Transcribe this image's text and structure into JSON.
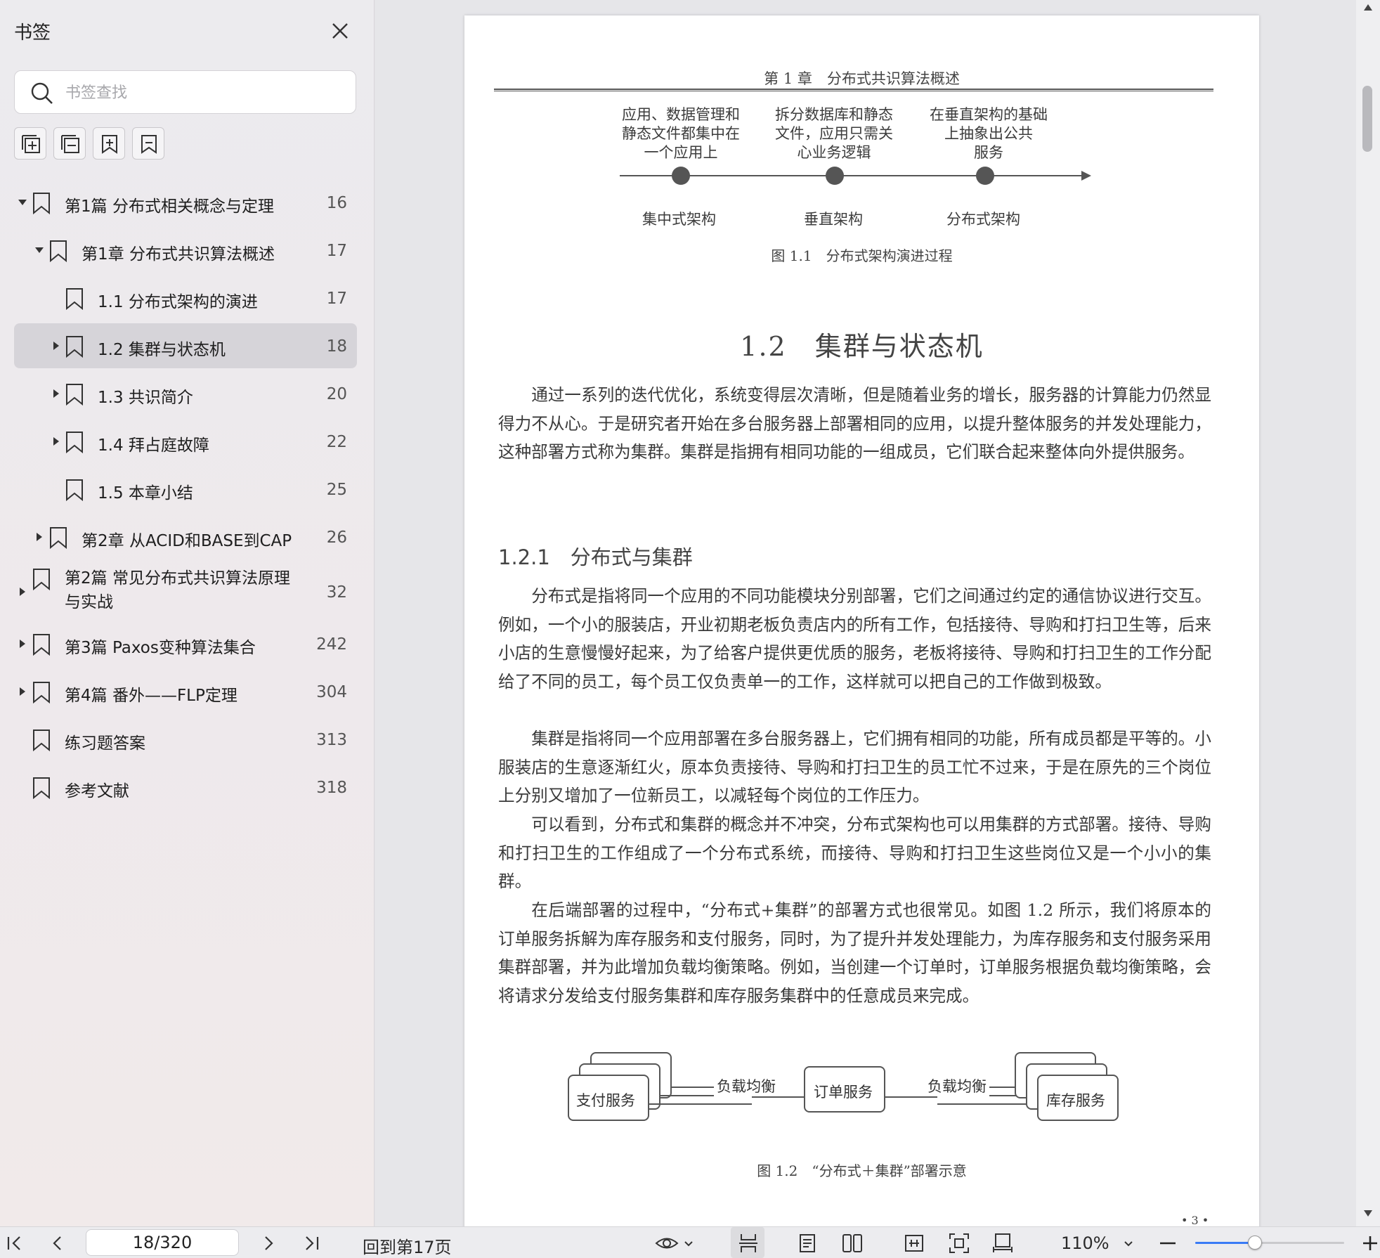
{
  "sidebar": {
    "title": "书签",
    "search_placeholder": "书签查找",
    "items": [
      {
        "label": "第1篇 分布式相关概念与定理",
        "page": "16"
      },
      {
        "label": "第1章 分布式共识算法概述",
        "page": "17"
      },
      {
        "label": "1.1 分布式架构的演进",
        "page": "17"
      },
      {
        "label": "1.2 集群与状态机",
        "page": "18"
      },
      {
        "label": "1.3 共识简介",
        "page": "20"
      },
      {
        "label": "1.4 拜占庭故障",
        "page": "22"
      },
      {
        "label": "1.5 本章小结",
        "page": "25"
      },
      {
        "label": "第2章 从ACID和BASE到CAP",
        "page": "26"
      },
      {
        "label": "第2篇 常见分布式共识算法原理与实战",
        "page": "32"
      },
      {
        "label": "第3篇 Paxos变种算法集合",
        "page": "242"
      },
      {
        "label": "第4篇 番外——FLP定理",
        "page": "304"
      },
      {
        "label": "练习题答案",
        "page": "313"
      },
      {
        "label": "参考文献",
        "page": "318"
      }
    ]
  },
  "document": {
    "running_head": "第 1 章　分布式共识算法概述",
    "fig11": {
      "desc": [
        "应用、数据管理和\n静态文件都集中在\n一个应用上",
        "拆分数据库和静态\n文件，应用只需关\n心业务逻辑",
        "在垂直架构的基础\n上抽象出公共\n服务"
      ],
      "stages": [
        "集中式架构",
        "垂直架构",
        "分布式架构"
      ],
      "caption": "图 1.1　分布式架构演进过程"
    },
    "section_title": "1.2　集群与状态机",
    "intro_para": "通过一系列的迭代优化，系统变得层次清晰，但是随着业务的增长，服务器的计算能力仍然显得力不从心。于是研究者开始在多台服务器上部署相同的应用，以提升整体服务的并发处理能力，这种部署方式称为集群。集群是指拥有相同功能的一组成员，它们联合起来整体向外提供服务。",
    "subsection_title": "1.2.1　分布式与集群",
    "paras": [
      "分布式是指将同一个应用的不同功能模块分别部署，它们之间通过约定的通信协议进行交互。例如，一个小的服装店，开业初期老板负责店内的所有工作，包括接待、导购和打扫卫生等，后来小店的生意慢慢好起来，为了给客户提供更优质的服务，老板将接待、导购和打扫卫生的工作分配给了不同的员工，每个员工仅负责单一的工作，这样就可以把自己的工作做到极致。",
      "集群是指将同一个应用部署在多台服务器上，它们拥有相同的功能，所有成员都是平等的。小服装店的生意逐渐红火，原本负责接待、导购和打扫卫生的员工忙不过来，于是在原先的三个岗位上分别又增加了一位新员工，以减轻每个岗位的工作压力。",
      "可以看到，分布式和集群的概念并不冲突，分布式架构也可以用集群的方式部署。接待、导购和打扫卫生的工作组成了一个分布式系统，而接待、导购和打扫卫生这些岗位又是一个小小的集群。",
      "在后端部署的过程中，“分布式+集群”的部署方式也很常见。如图 1.2 所示，我们将原本的订单服务拆解为库存服务和支付服务，同时，为了提升并发处理能力，为库存服务和支付服务采用集群部署，并为此增加负载均衡策略。例如，当创建一个订单时，订单服务根据负载均衡策略，会将请求分发给支付服务集群和库存服务集群中的任意成员来完成。"
    ],
    "fig12": {
      "left_box": "支付服务",
      "center_box": "订单服务",
      "right_box": "库存服务",
      "lb_left": "负载均衡",
      "lb_right": "负载均衡",
      "caption": "图 1.2　“分布式＋集群”部署示意"
    },
    "page_number": "• 3 •"
  },
  "toolbar": {
    "page_indicator": "18/320",
    "back_label": "回到第17页",
    "zoom": "110%",
    "zoom_fraction": 0.4
  },
  "colors": {
    "accent": "#3a7bf6",
    "selected_row": "#d6d4d9"
  }
}
